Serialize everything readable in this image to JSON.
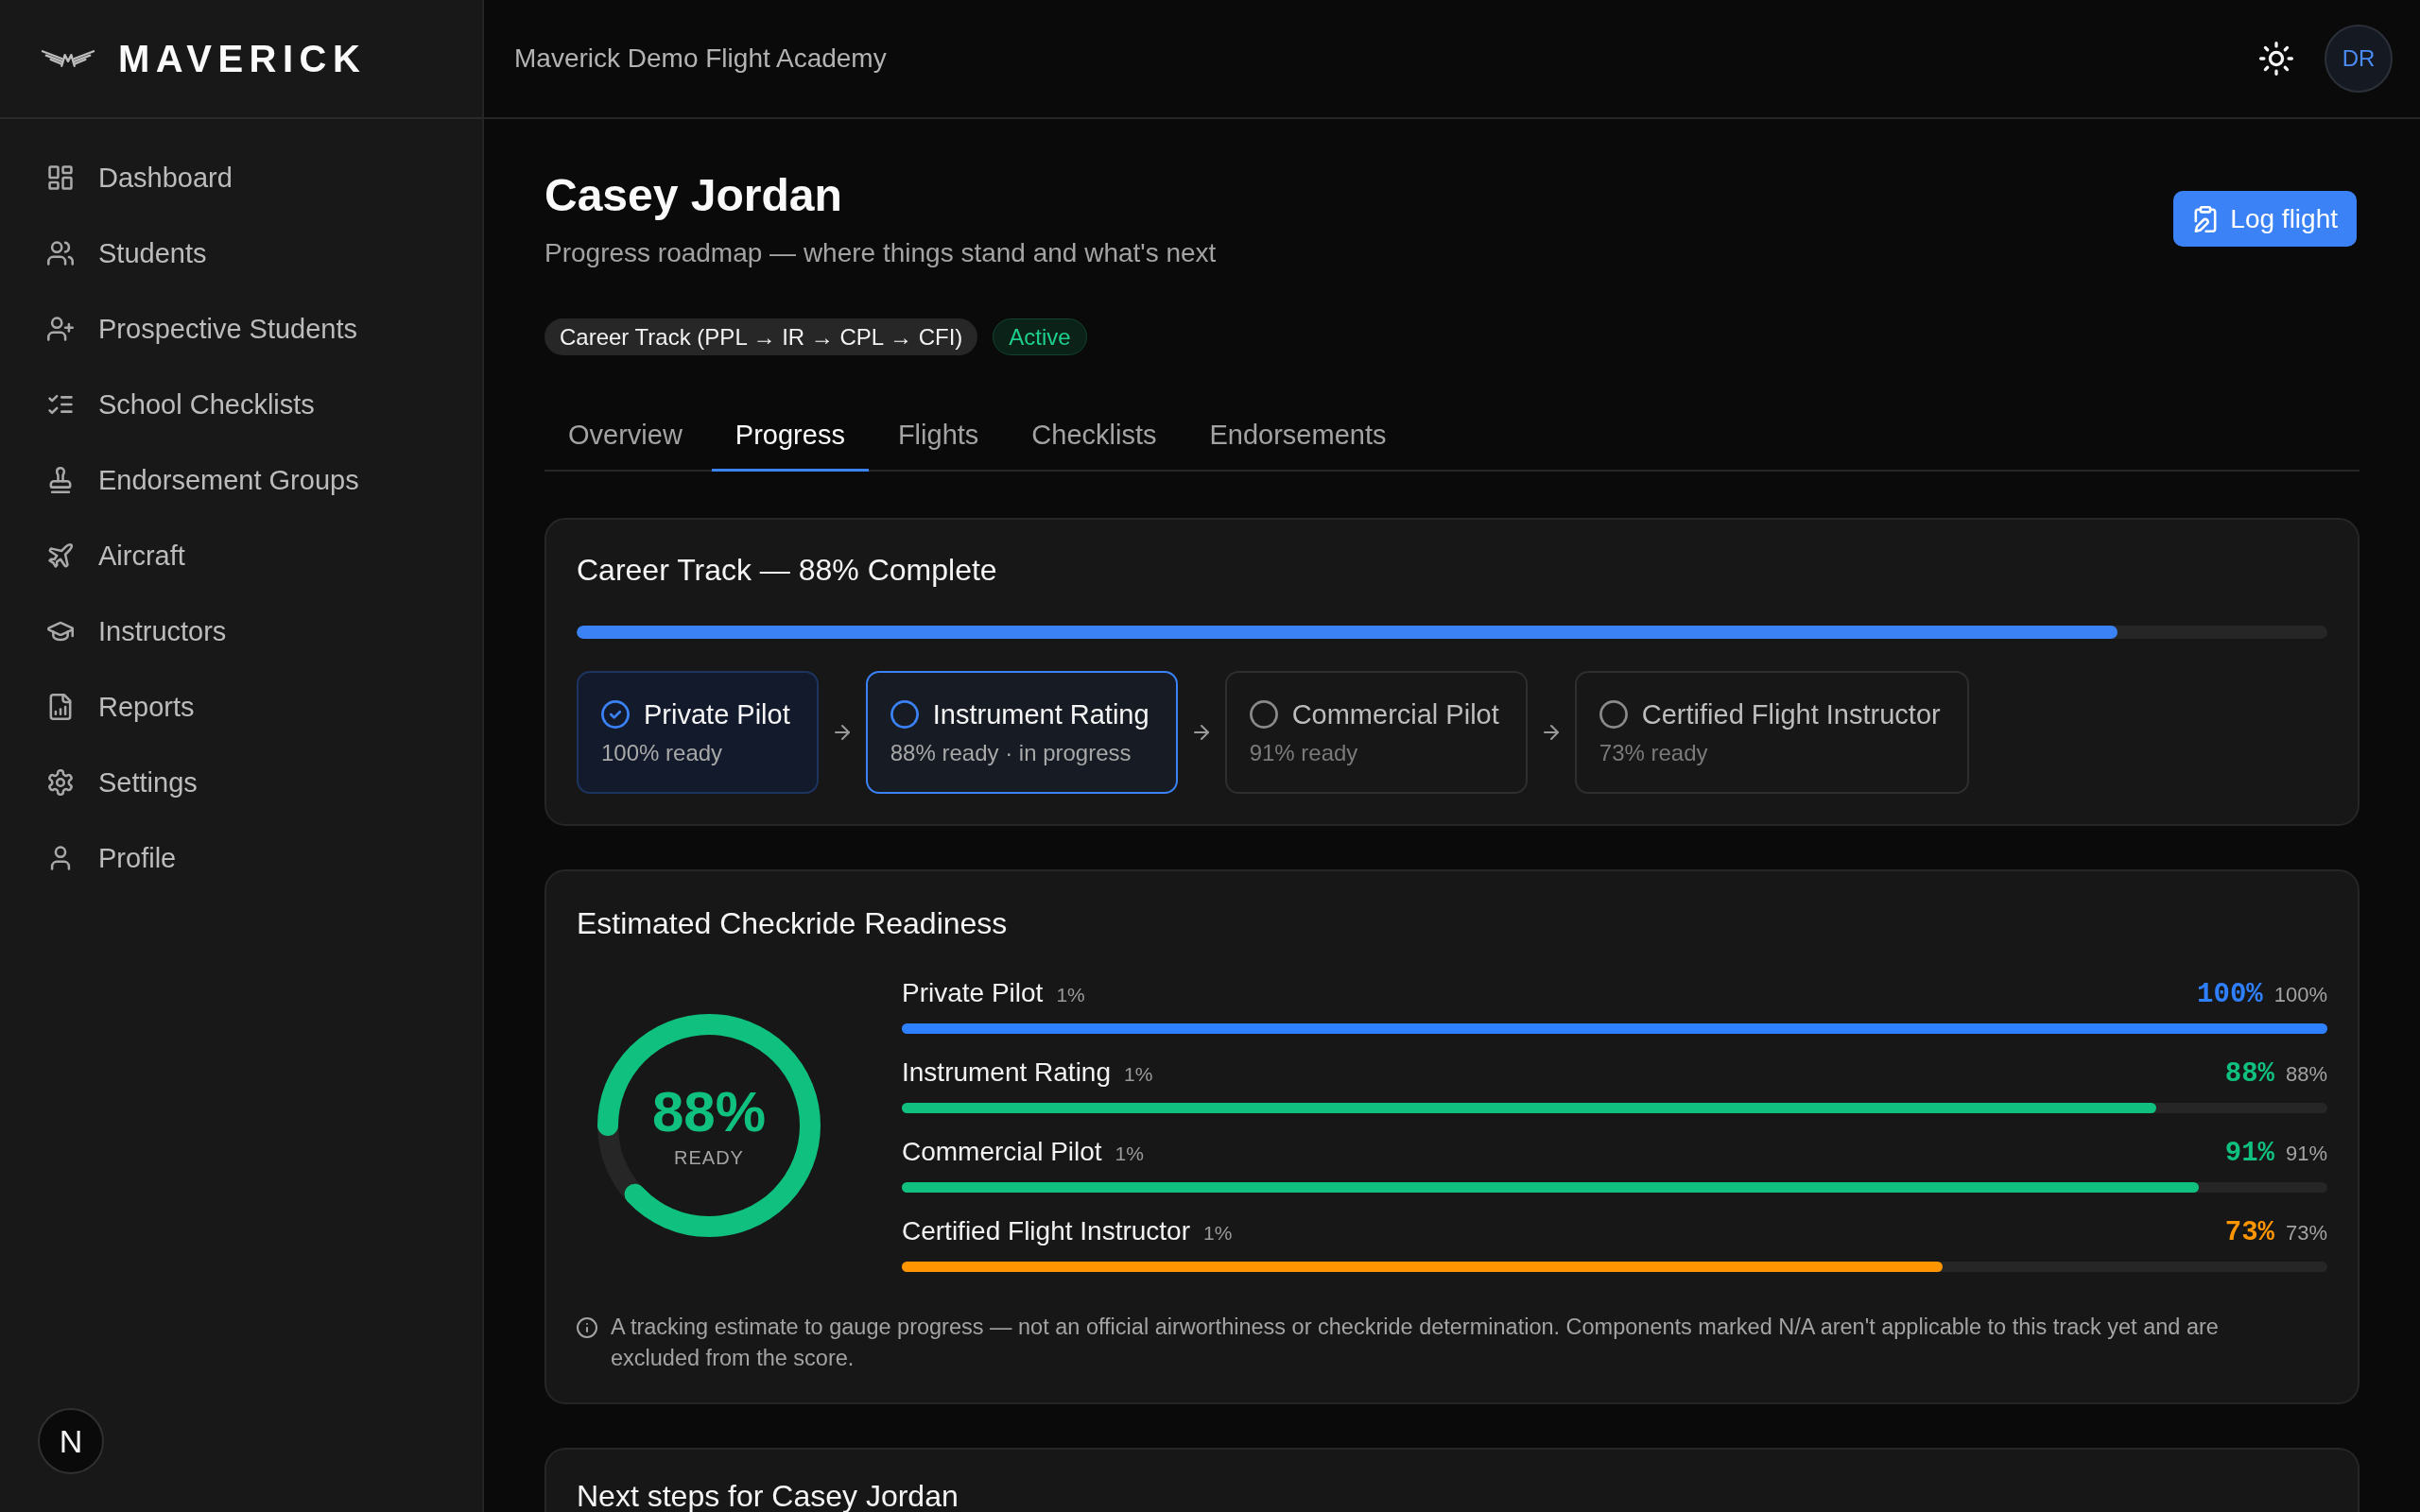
{
  "sidebar": {
    "brand": "MAVERICK",
    "items": [
      {
        "label": "Dashboard",
        "selected": false
      },
      {
        "label": "Students",
        "selected": false
      },
      {
        "label": "Prospective Students",
        "selected": false
      },
      {
        "label": "School Checklists",
        "selected": false
      },
      {
        "label": "Endorsement Groups",
        "selected": false
      },
      {
        "label": "Aircraft",
        "selected": false
      },
      {
        "label": "Instructors",
        "selected": false
      },
      {
        "label": "Reports",
        "selected": false
      },
      {
        "label": "Settings",
        "selected": false
      },
      {
        "label": "Profile",
        "selected": false
      }
    ],
    "dev_badge": "N"
  },
  "topbar": {
    "school_name": "Maverick Demo Flight Academy",
    "avatar_initials": "DR"
  },
  "header": {
    "title": "Casey Jordan",
    "subtitle": "Progress roadmap — where things stand and what's next",
    "action": "Log flight",
    "track_badge": "Career Track (PPL → IR → CPL → CFI)",
    "status_badge": "Active"
  },
  "tabs": [
    {
      "label": "Overview",
      "selected": false
    },
    {
      "label": "Progress",
      "selected": true
    },
    {
      "label": "Flights",
      "selected": false
    },
    {
      "label": "Checklists",
      "selected": false
    },
    {
      "label": "Endorsements",
      "selected": false
    }
  ],
  "career_track": {
    "title": "Career Track — 88% Complete",
    "level": 0.88,
    "stages": [
      {
        "name": "Private Pilot",
        "detail": "100% ready",
        "completed": true,
        "current": false
      },
      {
        "name": "Instrument Rating",
        "detail": "88% ready · in progress",
        "completed": false,
        "current": true
      },
      {
        "name": "Commercial Pilot",
        "detail": "91% ready",
        "completed": false,
        "current": false
      },
      {
        "name": "Certified Flight Instructor",
        "detail": "73% ready",
        "completed": false,
        "current": false
      }
    ]
  },
  "readiness": {
    "title": "Estimated Checkride Readiness",
    "overall": {
      "value": "88%",
      "caption": "READY",
      "level": 0.88
    },
    "rows": [
      {
        "name": "Private Pilot",
        "label_suffix": "1%",
        "score": "100%",
        "reading": "100%",
        "level": 1.0,
        "color": "#2f80ff"
      },
      {
        "name": "Instrument Rating",
        "label_suffix": "1%",
        "score": "88%",
        "reading": "88%",
        "level": 0.88,
        "color": "#10c07f"
      },
      {
        "name": "Commercial Pilot",
        "label_suffix": "1%",
        "score": "91%",
        "reading": "91%",
        "level": 0.91,
        "color": "#10c07f"
      },
      {
        "name": "Certified Flight Instructor",
        "label_suffix": "1%",
        "score": "73%",
        "reading": "73%",
        "level": 0.73,
        "color": "#ff9500"
      }
    ],
    "note": "A tracking estimate to gauge progress — not an official airworthiness or checkride determination. Components marked N/A aren't applicable to this track yet and are excluded from the score."
  },
  "next_steps": {
    "title": "Next steps for Casey Jordan"
  }
}
